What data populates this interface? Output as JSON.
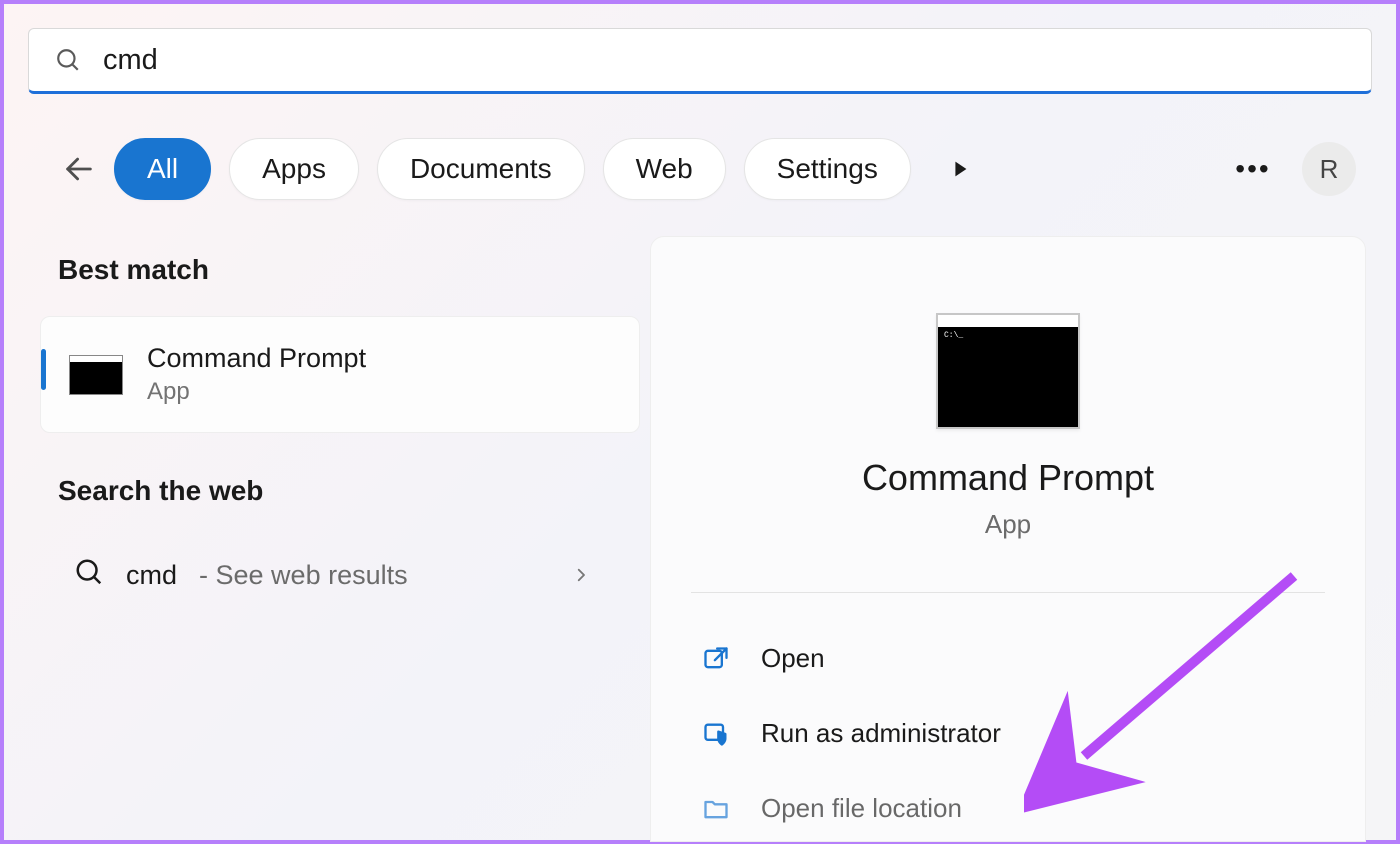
{
  "search": {
    "value": "cmd"
  },
  "filters": {
    "tabs": [
      "All",
      "Apps",
      "Documents",
      "Web",
      "Settings"
    ],
    "active_index": 0
  },
  "avatar_letter": "R",
  "left": {
    "best_match_heading": "Best match",
    "best_match": {
      "title": "Command Prompt",
      "subtitle": "App"
    },
    "web_heading": "Search the web",
    "web_row": {
      "term": "cmd",
      "hint": "- See web results"
    }
  },
  "preview": {
    "title": "Command Prompt",
    "subtitle": "App",
    "actions": [
      "Open",
      "Run as administrator",
      "Open file location"
    ]
  }
}
